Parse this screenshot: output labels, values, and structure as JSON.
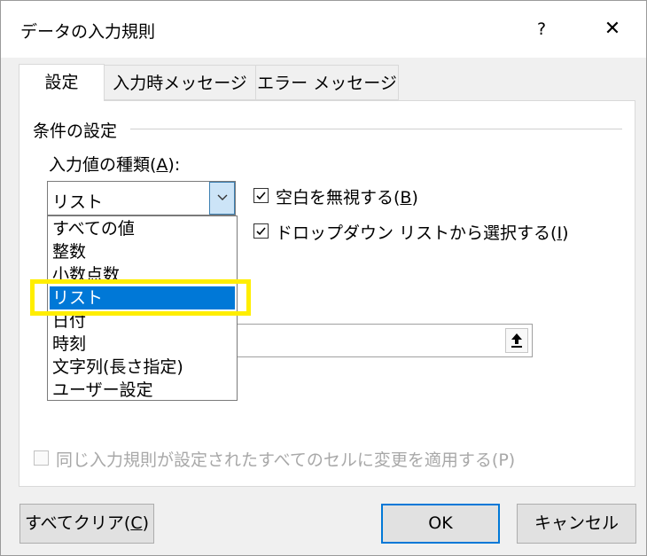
{
  "window": {
    "title": "データの入力規則",
    "help_symbol": "?",
    "close_symbol": "✕"
  },
  "tabs": [
    {
      "label": "設定",
      "active": true
    },
    {
      "label": "入力時メッセージ",
      "active": false
    },
    {
      "label": "エラー メッセージ",
      "active": false
    }
  ],
  "settings": {
    "group_label": "条件の設定",
    "type_label_prefix": "入力値の種類(",
    "type_label_key": "A",
    "type_label_suffix": "):",
    "type_value": "リスト",
    "type_options": [
      "すべての値",
      "整数",
      "小数点数",
      "リスト",
      "日付",
      "時刻",
      "文字列(長さ指定)",
      "ユーザー設定"
    ],
    "selected_option_index": 3,
    "ignore_blank": {
      "label_prefix": "空白を無視する(",
      "key": "B",
      "label_suffix": ")",
      "checked": true
    },
    "in_cell_dropdown": {
      "label_prefix": "ドロップダウン リストから選択する(",
      "key": "I",
      "label_suffix": ")",
      "checked": true
    },
    "source_value": "",
    "apply_all": {
      "label": "同じ入力規則が設定されたすべてのセルに変更を適用する(P)",
      "checked": false,
      "enabled": false
    }
  },
  "buttons": {
    "clear_prefix": "すべてクリア(",
    "clear_key": "C",
    "clear_suffix": ")",
    "ok": "OK",
    "cancel": "キャンセル"
  },
  "colors": {
    "selection": "#0078d7",
    "highlight": "#ffee00"
  }
}
